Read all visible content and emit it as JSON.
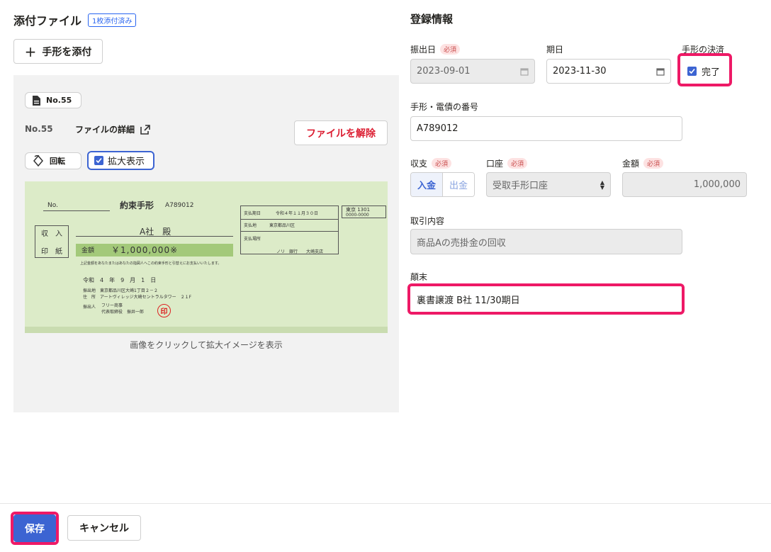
{
  "attachments": {
    "title": "添付ファイル",
    "badge": "1枚添付済み",
    "add_button": "手形を添付",
    "doc_pill": "No.55",
    "doc_number": "No.55",
    "detail_link": "ファイルの詳細",
    "remove_button": "ファイルを解除",
    "rotate_button": "回転",
    "zoom_label": "拡大表示",
    "zoom_checked": true,
    "caption": "画像をクリックして拡大イメージを表示"
  },
  "bill": {
    "no_label": "No.",
    "title": "約束手形",
    "number": "A789012",
    "payee": "A社　殿",
    "stamp_box_1": "収　入",
    "stamp_box_2": "印　紙",
    "amount_label": "金額",
    "amount": "￥1,000,000※",
    "notice": "上記金額をあなたまたはあなたの指図人へこの約束手形と引替えにお支払いいたします。",
    "issue_date": "令和　4　年　9　月　1　日",
    "issue_place": "振出地　東京都品川区大崎1丁目２－２",
    "address": "住　所　アートヴィレッジ大崎セントラルタワー　２１F",
    "issuer_label": "振出人",
    "issuer_company": "フリー商事",
    "issuer_name": "代表取締役　振井一郎",
    "seal": "印",
    "due_label": "支払期日",
    "due_value": "令和４年１１月３０日",
    "pay_place_label": "支払地",
    "pay_place_value": "東京都品川区",
    "payer_label": "支払場所",
    "bank": "ノリ　銀行　　大崎支店",
    "code_1": "東京 1301",
    "code_2": "0000-0000"
  },
  "registration": {
    "title": "登録情報",
    "required_badge": "必須",
    "issue_date_label": "振出日",
    "issue_date": "2023-09-01",
    "due_date_label": "期日",
    "due_date": "2023-11-30",
    "settlement_label": "手形の決済",
    "settlement_checkbox": "完了",
    "settlement_checked": true,
    "number_label": "手形・電債の番号",
    "number_value": "A789012",
    "income_label": "収支",
    "income_in": "入金",
    "income_out": "出金",
    "account_label": "口座",
    "account_value": "受取手形口座",
    "amount_label": "金額",
    "amount_value": "1,000,000",
    "memo_label": "取引内容",
    "memo_value": "商品Aの売掛金の回収",
    "outcome_label": "顛末",
    "outcome_value": "裏書譲渡 B社 11/30期日"
  },
  "footer": {
    "save": "保存",
    "cancel": "キャンセル"
  },
  "colors": {
    "primary": "#3c64d2",
    "highlight": "#ee1966",
    "danger": "#dc1e32"
  }
}
